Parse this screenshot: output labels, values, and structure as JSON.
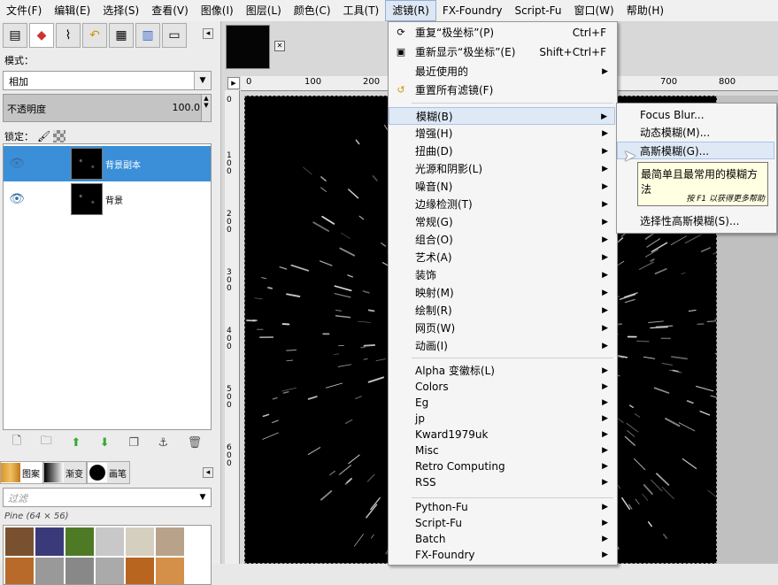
{
  "menubar": {
    "items": [
      "文件(F)",
      "编辑(E)",
      "选择(S)",
      "查看(V)",
      "图像(I)",
      "图层(L)",
      "颜色(C)",
      "工具(T)",
      "滤镜(R)",
      "FX-Foundry",
      "Script-Fu",
      "窗口(W)",
      "帮助(H)"
    ],
    "active_index": 8
  },
  "dock": {
    "mode_label": "模式：",
    "mode_value": "相加",
    "opacity_label": "不透明度",
    "opacity_value": "100.0",
    "lock_label": "锁定：",
    "layers": [
      {
        "name": "背景副本",
        "selected": true
      },
      {
        "name": "背景",
        "selected": false
      }
    ],
    "brush_tabs": [
      "图案",
      "渐变",
      "画笔"
    ],
    "filter_placeholder": "过滤",
    "pattern_name": "Pine (64 × 56)"
  },
  "ruler": {
    "h_ticks": [
      "0",
      "100",
      "200",
      "700",
      "800"
    ],
    "v_ticks": [
      "0",
      "1 0 0",
      "2 0 0",
      "3 0 0",
      "4 0 0",
      "5 0 0",
      "6 0 0"
    ]
  },
  "filters_menu": {
    "top_items": [
      {
        "label": "重复“极坐标”(P)",
        "shortcut": "Ctrl+F",
        "icon": "repeat-icon"
      },
      {
        "label": "重新显示“极坐标”(E)",
        "shortcut": "Shift+Ctrl+F",
        "icon": "reshow-icon"
      },
      {
        "label": "最近使用的",
        "submenu": true
      },
      {
        "label": "重置所有滤镜(F)",
        "icon": "reset-icon"
      }
    ],
    "groups_a": [
      {
        "label": "模糊(B)",
        "highlighted": true
      },
      {
        "label": "增强(H)"
      },
      {
        "label": "扭曲(D)"
      },
      {
        "label": "光源和阴影(L)"
      },
      {
        "label": "噪音(N)"
      },
      {
        "label": "边缘检测(T)"
      },
      {
        "label": "常规(G)"
      },
      {
        "label": "组合(O)"
      },
      {
        "label": "艺术(A)"
      },
      {
        "label": "装饰"
      },
      {
        "label": "映射(M)"
      },
      {
        "label": "绘制(R)"
      },
      {
        "label": "网页(W)"
      },
      {
        "label": "动画(I)"
      }
    ],
    "groups_b": [
      {
        "label": "Alpha 变徽标(L)"
      },
      {
        "label": "Colors"
      },
      {
        "label": "Eg"
      },
      {
        "label": "jp"
      },
      {
        "label": "Kward1979uk"
      },
      {
        "label": "Misc"
      },
      {
        "label": "Retro Computing"
      },
      {
        "label": "RSS"
      }
    ],
    "groups_c": [
      {
        "label": "Python-Fu"
      },
      {
        "label": "Script-Fu"
      },
      {
        "label": "Batch"
      },
      {
        "label": "FX-Foundry"
      }
    ]
  },
  "blur_submenu": {
    "items": [
      {
        "label": "Focus Blur..."
      },
      {
        "label": "动态模糊(M)..."
      },
      {
        "label": "高斯模糊(G)...",
        "highlighted": true
      },
      {
        "label": "选择性高斯模糊(S)..."
      }
    ]
  },
  "tooltip": {
    "text": "最简单且最常用的模糊方法",
    "hint": "按 F1 以获得更多帮助"
  },
  "colors": {
    "selection": "#3a8fd8",
    "menu_highlight": "#dfe9f5",
    "tooltip_bg": "#ffffe1"
  }
}
